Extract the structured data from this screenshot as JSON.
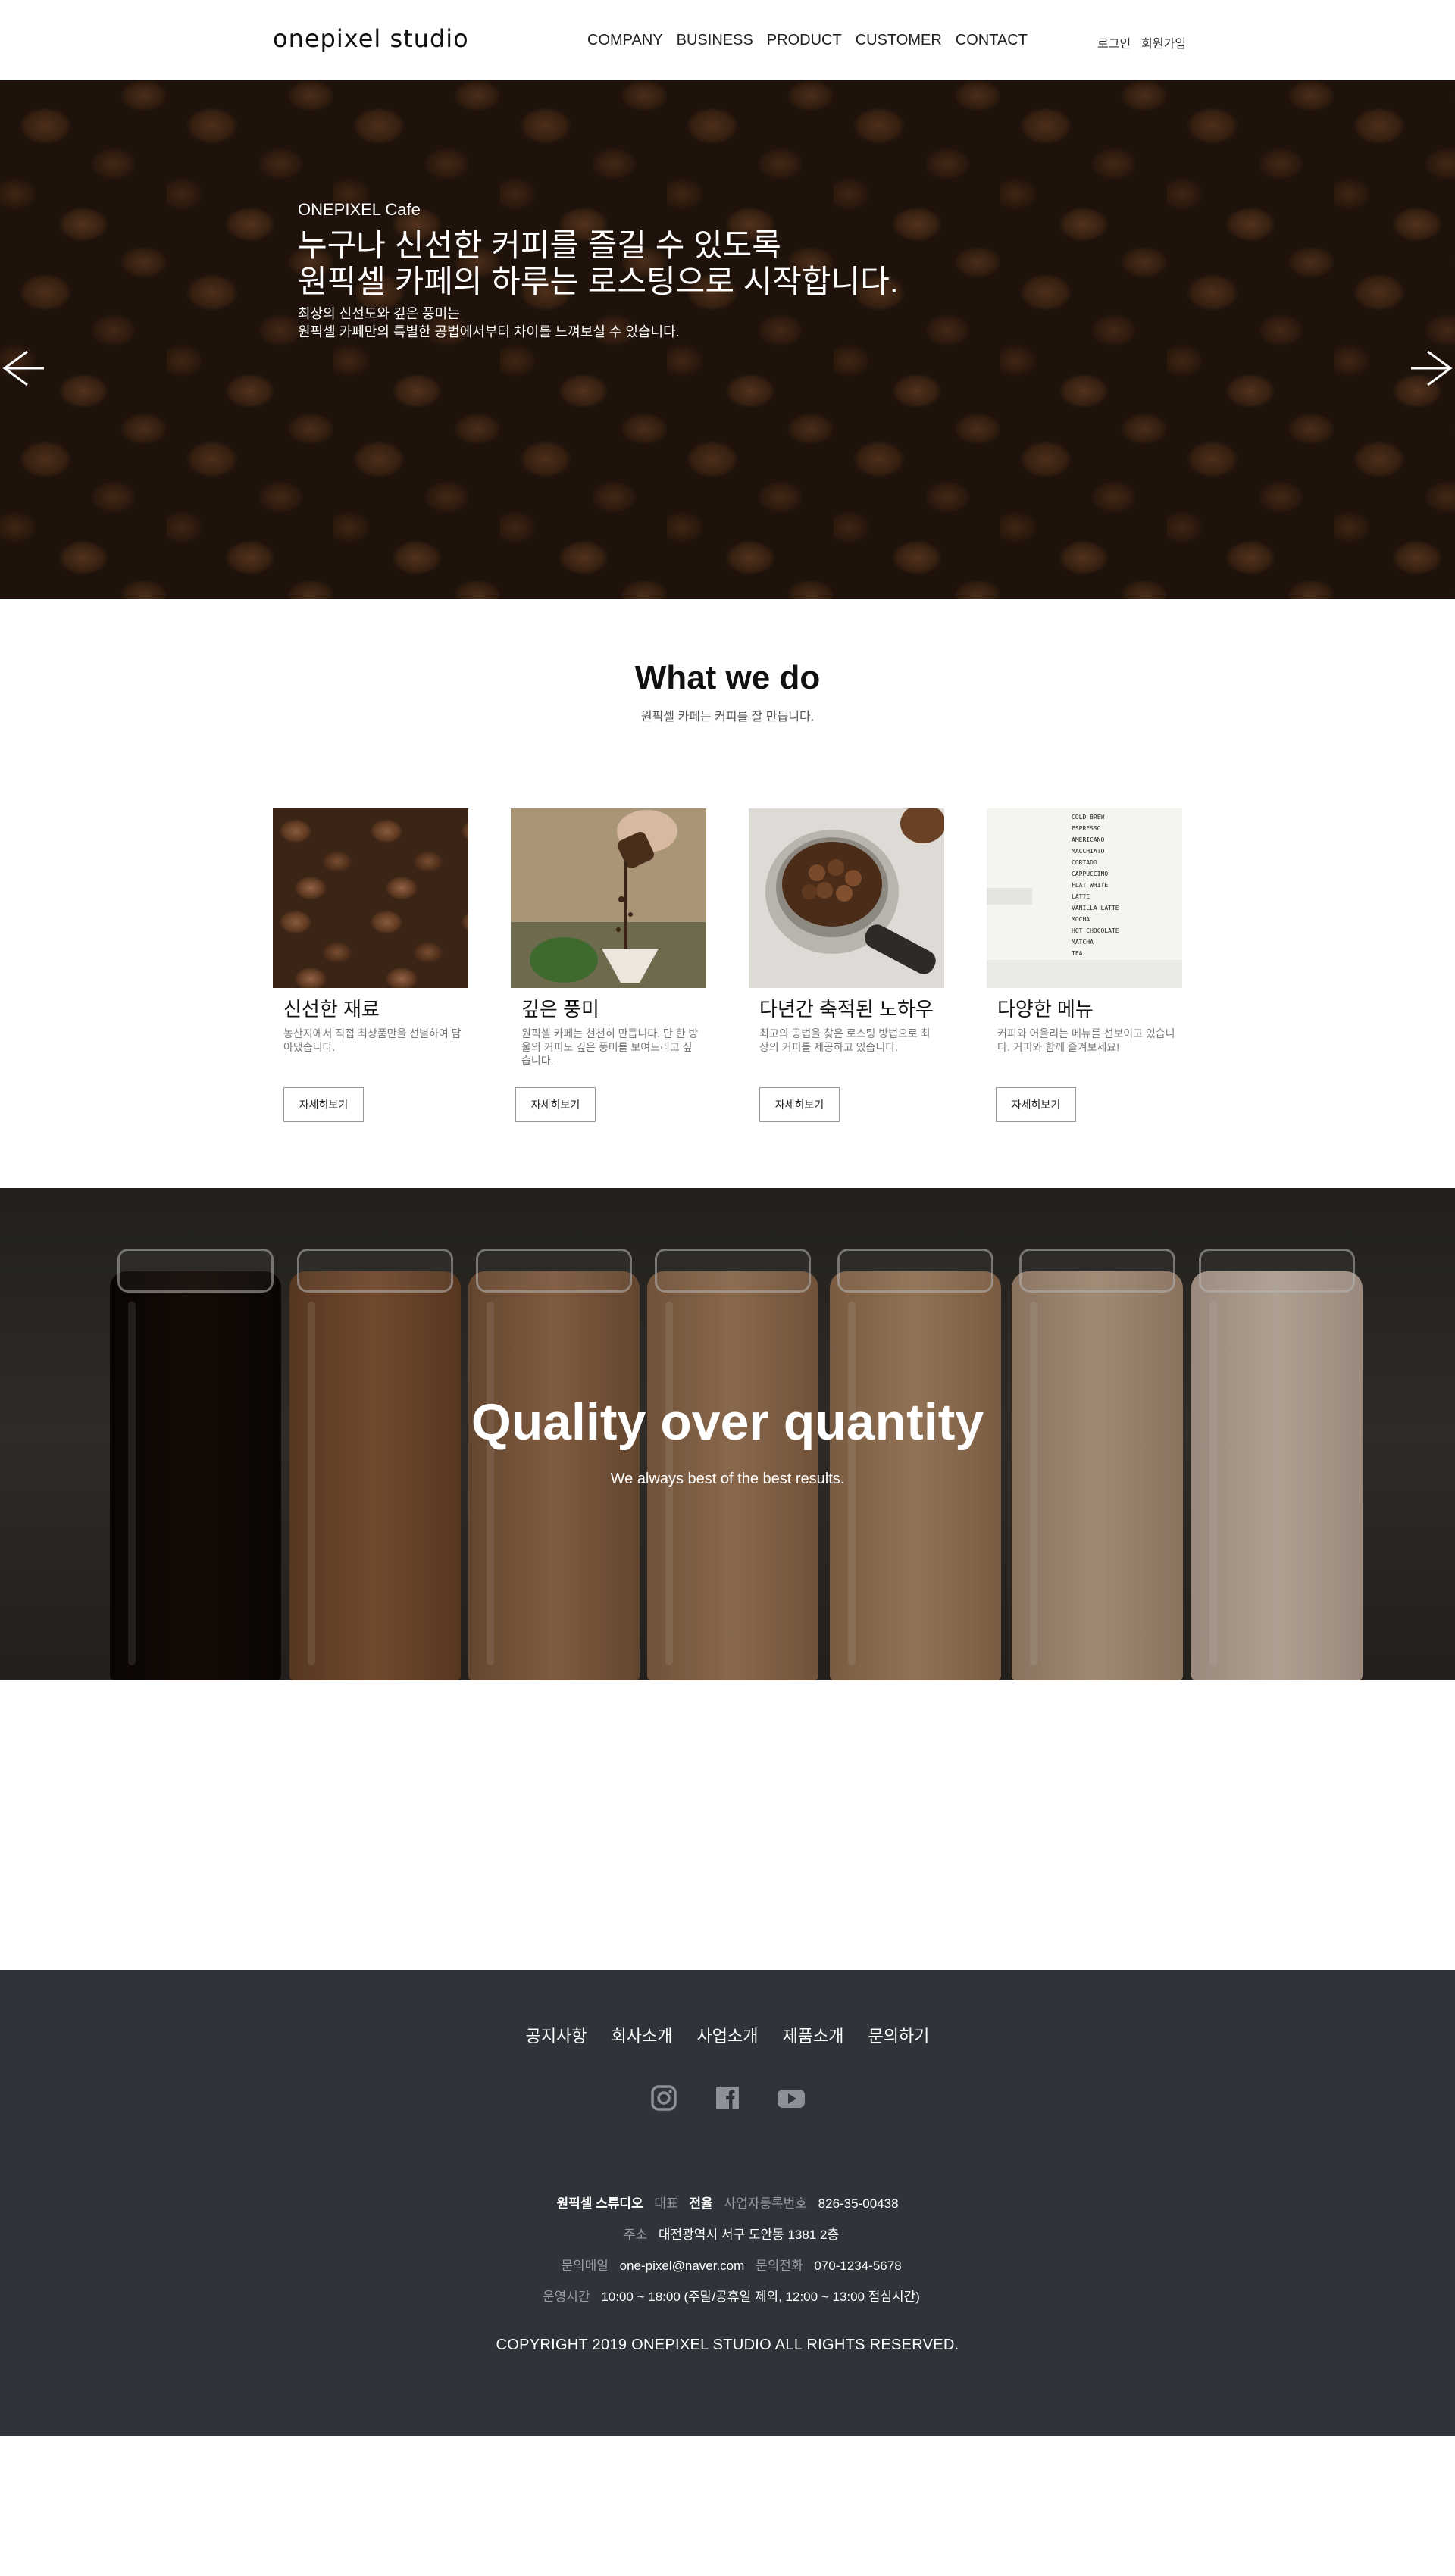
{
  "header": {
    "logo": "onepixel studio",
    "nav": [
      "COMPANY",
      "BUSINESS",
      "PRODUCT",
      "CUSTOMER",
      "CONTACT"
    ],
    "login": "로그인",
    "signup": "회원가입"
  },
  "hero": {
    "eyebrow": "ONEPIXEL Cafe",
    "title_line1": "누구나 신선한 커피를 즐길 수 있도록",
    "title_line2": "원픽셀 카페의 하루는 로스팅으로 시작합니다.",
    "desc_line1": "최상의 신선도와 깊은 풍미는",
    "desc_line2": "원픽셀 카페만의 특별한 공법에서부터 차이를 느껴보실 수 있습니다.",
    "prev_icon": "arrow-left-icon",
    "next_icon": "arrow-right-icon"
  },
  "what_we_do": {
    "title": "What we do",
    "subtitle": "원픽셀 카페는 커피를 잘 만듭니다.",
    "cards": [
      {
        "title": "신선한 재료",
        "text": "농산지에서 직접 최상품만을 선별하여 담아냈습니다.",
        "button": "자세히보기"
      },
      {
        "title": "깊은 풍미",
        "text": "원픽셀 카페는 천천히 만듭니다. 단 한 방울의 커피도 깊은 풍미를 보여드리고 싶습니다.",
        "button": "자세히보기"
      },
      {
        "title": "다년간 축적된 노하우",
        "text": "최고의 공법을 찾은 로스팅 방법으로 최상의 커피를 제공하고 있습니다.",
        "button": "자세히보기"
      },
      {
        "title": "다양한 메뉴",
        "text": "커피와 어울리는 메뉴를 선보이고 있습니다. 커피와 함께 즐겨보세요!",
        "button": "자세히보기"
      }
    ],
    "menu_board": [
      "COLD BREW",
      "ESPRESSO",
      "AMERICANO",
      "MACCHIATO",
      "CORTADO",
      "CAPPUCCINO",
      "FLAT WHITE",
      "LATTE",
      "VANILLA LATTE",
      "MOCHA",
      "HOT CHOCOLATE",
      "MATCHA",
      "TEA"
    ]
  },
  "quality": {
    "title": "Quality over quantity",
    "subtitle": "We always best of the best results."
  },
  "footer": {
    "menu": [
      "공지사항",
      "회사소개",
      "사업소개",
      "제품소개",
      "문의하기"
    ],
    "social": [
      "instagram-icon",
      "facebook-icon",
      "youtube-icon"
    ],
    "company_name": "원픽셀 스튜디오",
    "ceo_label": "대표",
    "ceo": "전율",
    "biz_label": "사업자등록번호",
    "biz_no": "826-35-00438",
    "addr_label": "주소",
    "addr": "대전광역시 서구 도안동 1381 2층",
    "email_label": "문의메일",
    "email": "one-pixel@naver.com",
    "phone_label": "문의전화",
    "phone": "070-1234-5678",
    "hours_label": "운영시간",
    "hours": "10:00 ~ 18:00 (주말/공휴일 제외, 12:00 ~ 13:00 점심시간)",
    "copyright": "COPYRIGHT 2019 ONEPIXEL STUDIO ALL RIGHTS RESERVED."
  }
}
